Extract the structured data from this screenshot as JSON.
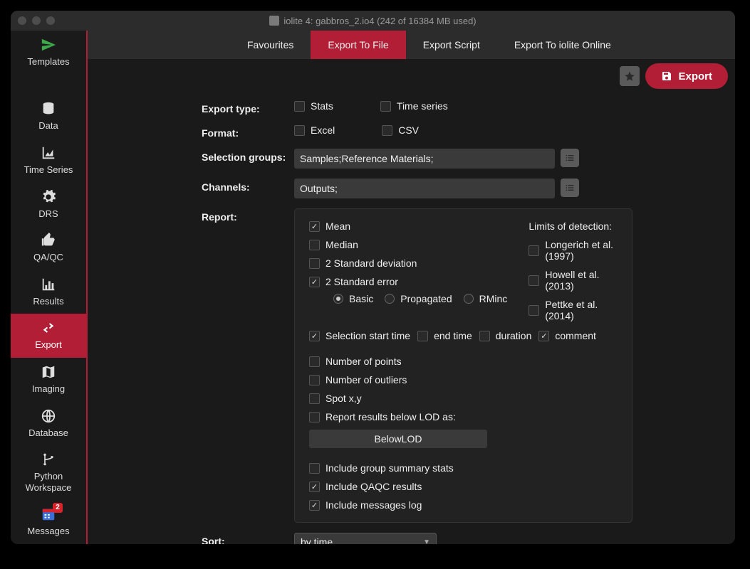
{
  "title": "iolite 4: gabbros_2.io4 (242 of 16384 MB used)",
  "sidebar": [
    {
      "key": "templates",
      "label": "Templates"
    },
    {
      "key": "data",
      "label": "Data"
    },
    {
      "key": "timeseries",
      "label": "Time Series"
    },
    {
      "key": "drs",
      "label": "DRS"
    },
    {
      "key": "qaqc",
      "label": "QA/QC"
    },
    {
      "key": "results",
      "label": "Results"
    },
    {
      "key": "export",
      "label": "Export"
    },
    {
      "key": "imaging",
      "label": "Imaging"
    },
    {
      "key": "database",
      "label": "Database"
    },
    {
      "key": "python",
      "label": "Python Workspace"
    },
    {
      "key": "messages",
      "label": "Messages",
      "badge": "2"
    }
  ],
  "tabs": [
    {
      "label": "Favourites"
    },
    {
      "label": "Export To File"
    },
    {
      "label": "Export Script"
    },
    {
      "label": "Export To iolite Online"
    }
  ],
  "export_button": "Export",
  "form": {
    "export_type": {
      "label": "Export type:",
      "stats": "Stats",
      "timeseries": "Time series"
    },
    "format": {
      "label": "Format:",
      "excel": "Excel",
      "csv": "CSV"
    },
    "selection_groups": {
      "label": "Selection groups:",
      "value": "Samples;Reference Materials;"
    },
    "channels": {
      "label": "Channels:",
      "value": "Outputs;"
    },
    "report": {
      "label": "Report:",
      "mean": "Mean",
      "median": "Median",
      "std2": "2 Standard deviation",
      "se2": "2 Standard error",
      "basic": "Basic",
      "propagated": "Propagated",
      "rminc": "RMinc",
      "lod_header": "Limits of detection:",
      "longerich": "Longerich et al. (1997)",
      "howell": "Howell et al. (2013)",
      "pettke": "Pettke et al. (2014)",
      "sel_start": "Selection start time",
      "end_time": "end time",
      "duration": "duration",
      "comment": "comment",
      "npoints": "Number of points",
      "noutliers": "Number of outliers",
      "spotxy": "Spot x,y",
      "below_lod_label": "Report results below LOD as:",
      "below_lod_value": "BelowLOD",
      "group_summary": "Include group summary stats",
      "qaqc_results": "Include QAQC results",
      "messages_log": "Include messages log"
    },
    "sort": {
      "label": "Sort:",
      "value": "by time"
    }
  }
}
